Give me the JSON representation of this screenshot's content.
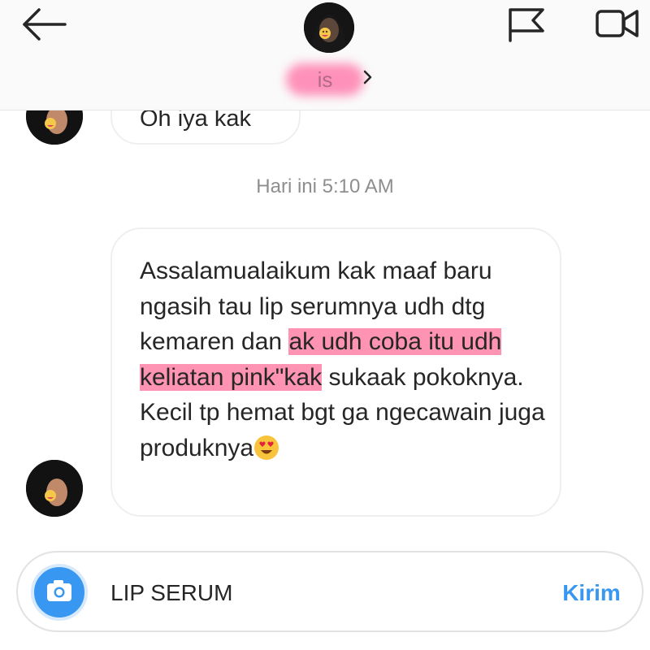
{
  "header": {
    "username": "is",
    "icons": {
      "back": "back-arrow-icon",
      "info": "chevron-right-icon",
      "flag": "flag-icon",
      "video": "video-call-icon"
    }
  },
  "thread": {
    "previous_message": "Oh iya kak",
    "timestamp": "Hari ini 5:10 AM",
    "message": {
      "part1": "Assalamualaikum kak maaf baru ngasih tau lip serumnya udh dtg kemaren dan ",
      "highlighted": "ak udh coba itu udh keliatan pink\"kak",
      "part2": " sukaak pokoknya. Kecil tp hemat bgt ga ngecawain juga produknya",
      "emoji": "heart-eyes-emoji",
      "highlight_color": "#ff6996"
    }
  },
  "composer": {
    "value": "LIP SERUM",
    "send_label": "Kirim",
    "camera_icon": "camera-icon",
    "accent_color": "#3897f0"
  }
}
